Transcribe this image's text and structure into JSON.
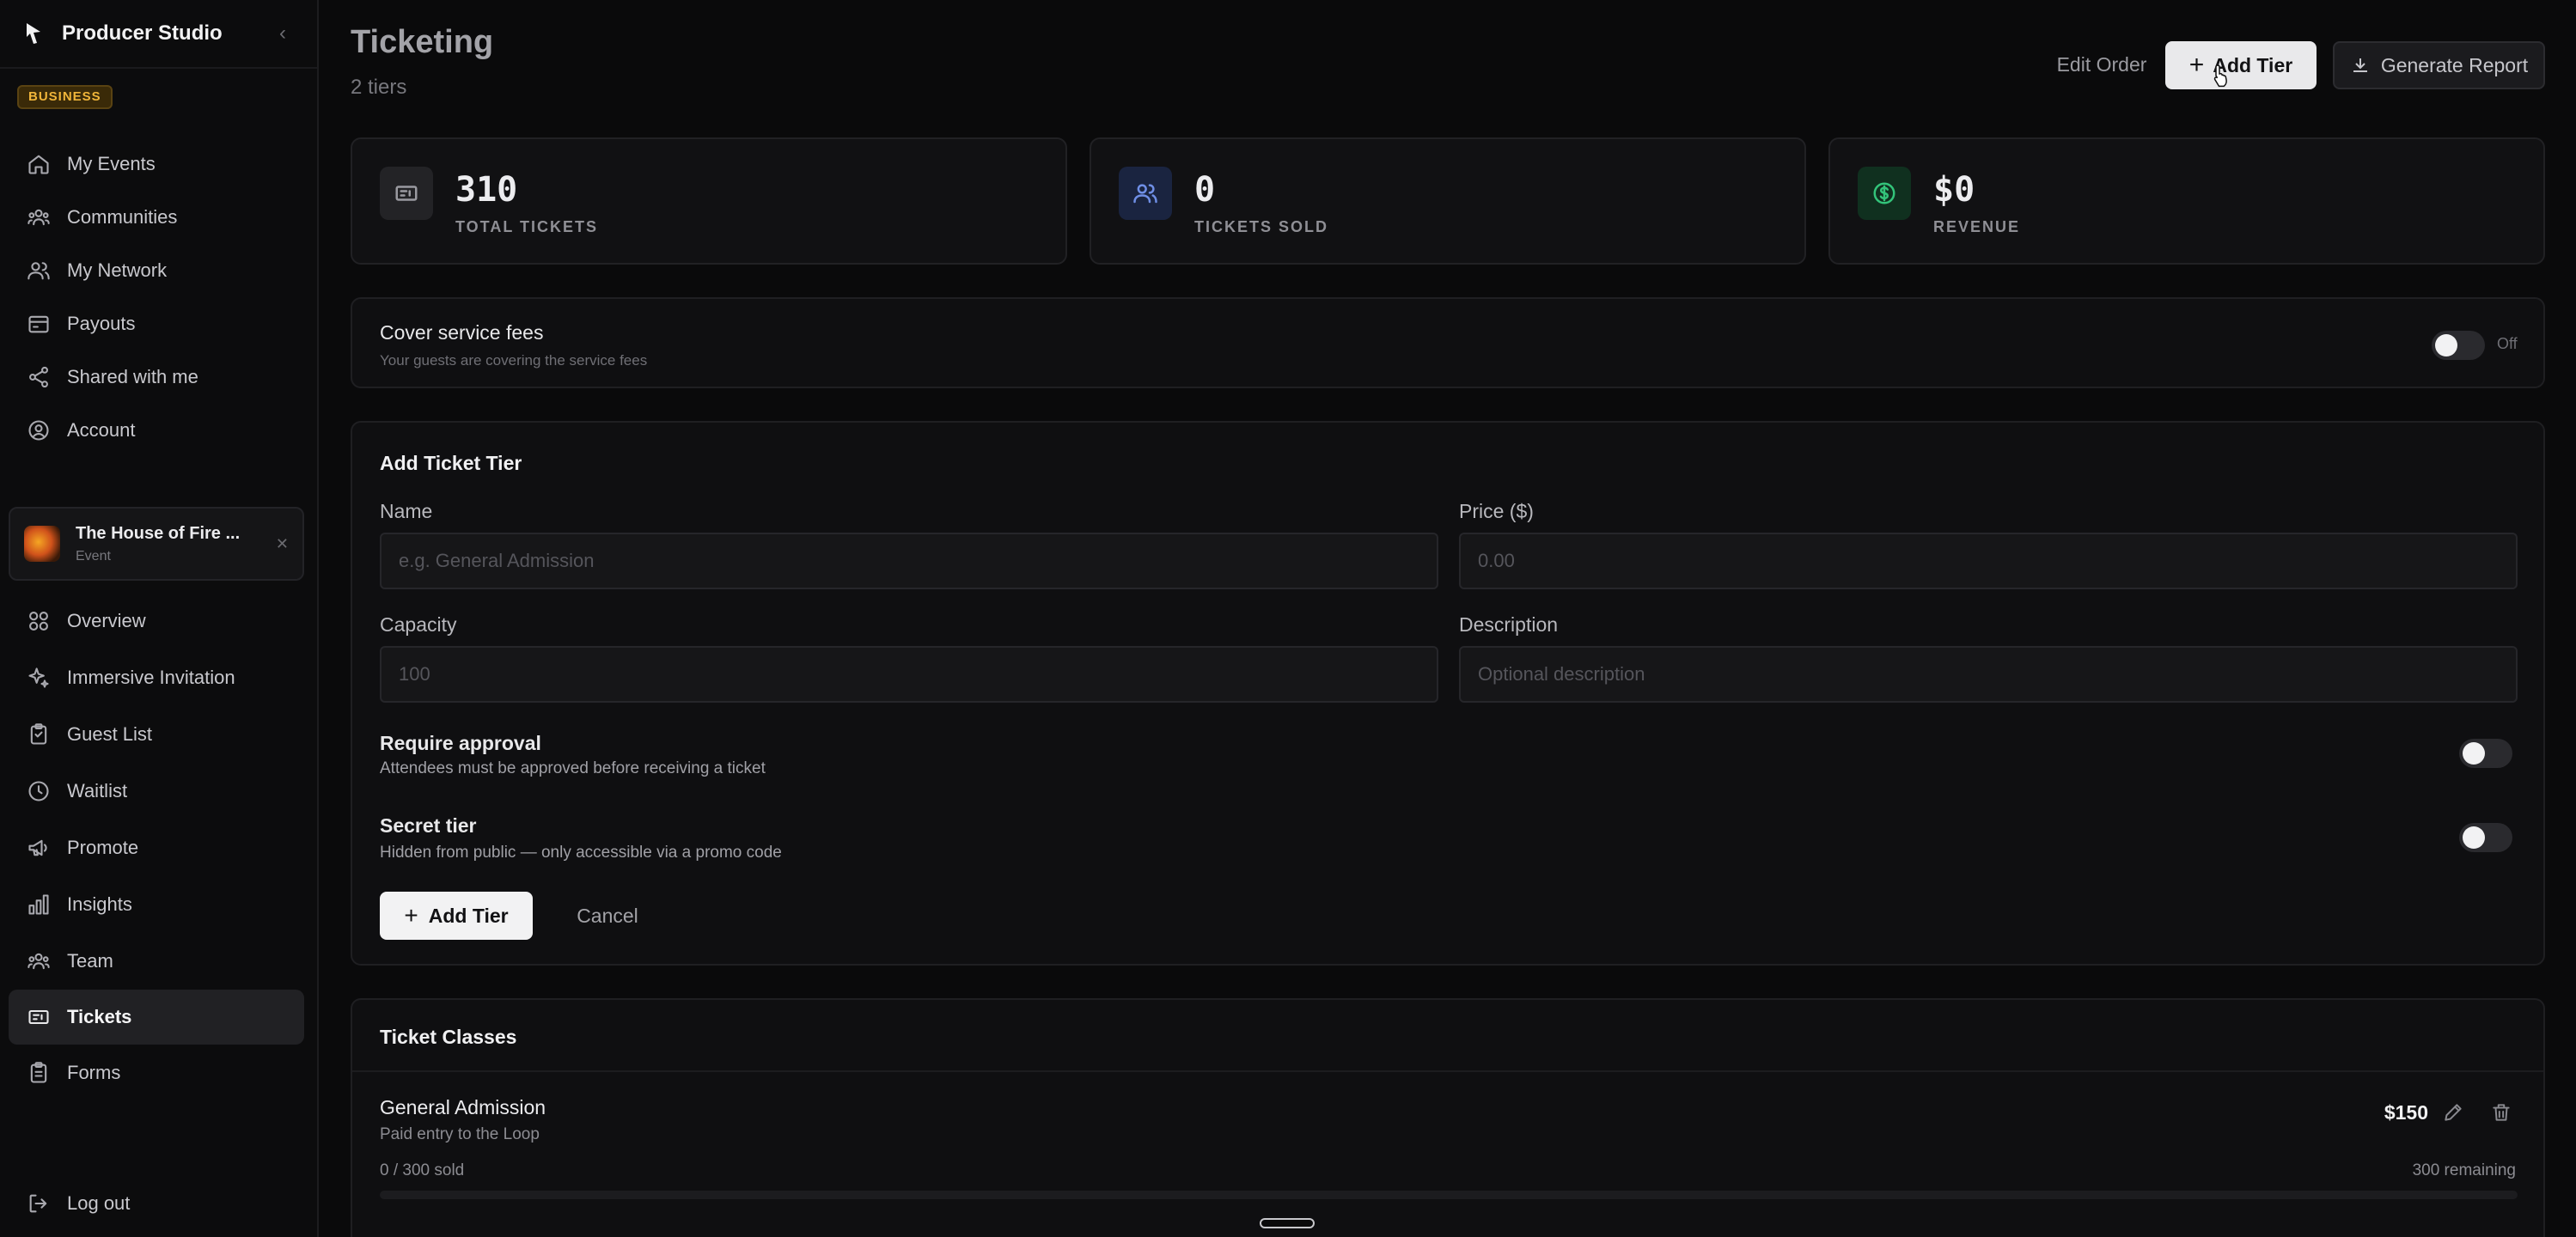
{
  "app": {
    "title": "Producer Studio",
    "plan": "BUSINESS"
  },
  "sidebar": {
    "top_items": [
      {
        "label": "My Events",
        "icon": "home-icon"
      },
      {
        "label": "Communities",
        "icon": "communities-icon"
      },
      {
        "label": "My Network",
        "icon": "network-icon"
      },
      {
        "label": "Payouts",
        "icon": "wallet-icon"
      },
      {
        "label": "Shared with me",
        "icon": "share-icon"
      },
      {
        "label": "Account",
        "icon": "account-icon"
      }
    ],
    "event": {
      "name": "The House of Fire ...",
      "type": "Event"
    },
    "event_items": [
      {
        "label": "Overview",
        "icon": "grid-icon"
      },
      {
        "label": "Immersive Invitation",
        "icon": "sparkle-icon"
      },
      {
        "label": "Guest List",
        "icon": "clipboard-icon"
      },
      {
        "label": "Waitlist",
        "icon": "clock-icon"
      },
      {
        "label": "Promote",
        "icon": "megaphone-icon"
      },
      {
        "label": "Insights",
        "icon": "bar-chart-icon"
      },
      {
        "label": "Team",
        "icon": "team-icon"
      },
      {
        "label": "Tickets",
        "icon": "ticket-icon",
        "active": true
      },
      {
        "label": "Forms",
        "icon": "form-icon"
      }
    ],
    "logout": "Log out"
  },
  "header": {
    "title": "Ticketing",
    "subtitle": "2 tiers",
    "edit_order": "Edit Order",
    "add_tier": "Add Tier",
    "generate_report": "Generate Report"
  },
  "stats": [
    {
      "value": "310",
      "label": "TOTAL TICKETS",
      "icon": "ticket-icon",
      "color": "#9a9aa0"
    },
    {
      "value": "0",
      "label": "TICKETS SOLD",
      "icon": "users-icon",
      "color": "#6f8fe6"
    },
    {
      "value": "$0",
      "label": "REVENUE",
      "icon": "dollar-icon",
      "color": "#33c47a"
    }
  ],
  "service_fees": {
    "title": "Cover service fees",
    "subtitle": "Your guests are covering the service fees",
    "state": "Off"
  },
  "add_tier_form": {
    "title": "Add Ticket Tier",
    "name_label": "Name",
    "name_placeholder": "e.g. General Admission",
    "price_label": "Price ($)",
    "price_placeholder": "0.00",
    "capacity_label": "Capacity",
    "capacity_placeholder": "100",
    "description_label": "Description",
    "description_placeholder": "Optional description",
    "approval_title": "Require approval",
    "approval_subtitle": "Attendees must be approved before receiving a ticket",
    "secret_title": "Secret tier",
    "secret_subtitle": "Hidden from public — only accessible via a promo code",
    "submit": "Add Tier",
    "cancel": "Cancel"
  },
  "ticket_classes": {
    "title": "Ticket Classes",
    "tiers": [
      {
        "name": "General Admission",
        "description": "Paid entry to the Loop",
        "price": "$150",
        "sold": "0 / 300 sold",
        "remaining": "300 remaining",
        "progress": 0
      }
    ]
  }
}
